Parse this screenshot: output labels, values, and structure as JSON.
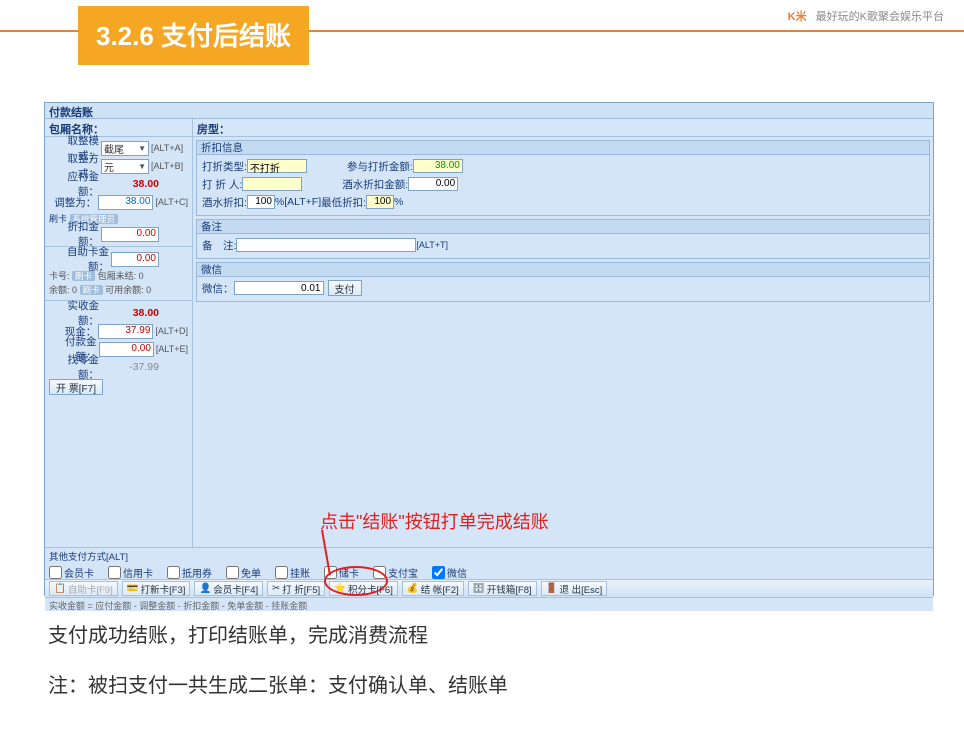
{
  "header": {
    "logo": "K米",
    "slogan": "最好玩的K歌聚会娱乐平台",
    "section_title": "3.2.6 支付后结账"
  },
  "window": {
    "title": "付款结账",
    "room_name_label": "包厢名称：",
    "room_type_label": "房型：",
    "left": {
      "round_mode_label": "取整模式：",
      "round_mode_value": "截尾",
      "round_mode_hint": "[ALT+A]",
      "round_way_label": "取整方式：",
      "round_way_value": "元",
      "round_way_hint": "[ALT+B]",
      "due_label": "应付金额：",
      "due_value": "38.00",
      "adjust_label": "调整为：",
      "adjust_value": "38.00",
      "adjust_hint": "[ALT+C]",
      "brush_label": "刷卡",
      "brush_tag": "系统管理员",
      "discount_amt_label": "折扣金额：",
      "discount_amt_value": "0.00",
      "selfcard_label": "自助卡金额：",
      "selfcard_value": "0.00",
      "card_no_label": "卡号:",
      "card_no_hint": "刷卡",
      "room_unpaid_label": "包厢未结:",
      "room_unpaid_value": "0",
      "balance_label": "余额:",
      "balance_hint": "刷卡",
      "balance_value": "0",
      "avail_label": "可用余额:",
      "avail_value": "0",
      "received_label": "实收金额：",
      "received_value": "38.00",
      "cash_label": "现金：",
      "cash_value": "37.99",
      "cash_hint": "[ALT+D]",
      "paid_label": "付款金额：",
      "paid_value": "0.00",
      "paid_hint": "[ALT+E]",
      "change_label": "找零金额：",
      "change_value": "-37.99",
      "invoice_btn": "开 票[F7]"
    },
    "discount_group": {
      "title": "折扣信息",
      "type_label": "打折类型:",
      "type_value": "不打折",
      "apply_amt_label": "参与打折金额:",
      "apply_amt_value": "38.00",
      "person_label": "打 折 人:",
      "wine_amt_label": "酒水折扣金额:",
      "wine_amt_value": "0.00",
      "wine_disc_label": "酒水折扣:",
      "wine_disc_value": "100",
      "wine_disc_hint": "%[ALT+F]",
      "min_disc_label": "最低折扣:",
      "min_disc_value": "100",
      "min_disc_unit": "%"
    },
    "remark_group": {
      "title": "备注",
      "label": "备　注:",
      "hint": "[ALT+T]"
    },
    "wechat_group": {
      "title": "微信",
      "label": "微信：",
      "value": "0.01",
      "pay_btn": "支付"
    },
    "other_pay": {
      "title": "其他支付方式[ALT]",
      "items": [
        "会员卡",
        "信用卡",
        "抵用券",
        "免单",
        "挂账",
        "储卡",
        "支付宝",
        "微信"
      ]
    },
    "actions": {
      "selfcard": "自助卡[F9]",
      "swipe": "打新卡[F3]",
      "member": "会员卡[F4]",
      "discount": "打 折[F5]",
      "points": "积分卡[F6]",
      "checkout": "结 帐[F2]",
      "wallet": "开钱箱[F8]",
      "exit": "退 出[Esc]"
    },
    "status": "实收金额 = 应付金额 - 调整金额 - 折扣金额 - 免单金额 - 挂账金额"
  },
  "callout": "点击\"结账\"按钮打单完成结账",
  "bottom": {
    "line1": "支付成功结账，打印结账单，完成消费流程",
    "line2": "注：被扫支付一共生成二张单：支付确认单、结账单"
  }
}
